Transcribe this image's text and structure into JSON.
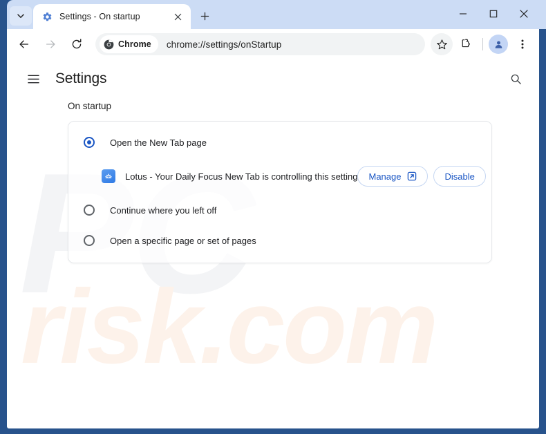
{
  "browser": {
    "tab": {
      "title": "Settings - On startup",
      "favicon_name": "settings-gear-icon",
      "close_name": "close-tab-icon"
    },
    "new_tab_label": "+",
    "tab_search_name": "tab-search-chevron-icon",
    "window_controls": {
      "minimize": "minimize-icon",
      "maximize": "maximize-icon",
      "close": "close-window-icon"
    },
    "toolbar": {
      "back": "back-arrow-icon",
      "forward": "forward-arrow-icon",
      "reload": "reload-icon",
      "chrome_chip_label": "Chrome",
      "url": "chrome://settings/onStartup",
      "bookmark": "star-icon",
      "extensions": "extensions-puzzle-icon",
      "profile": "profile-avatar-icon",
      "menu": "three-dot-menu-icon"
    }
  },
  "settings": {
    "menu_icon": "hamburger-menu-icon",
    "title": "Settings",
    "search_icon": "search-icon",
    "section_heading": "On startup",
    "options": [
      {
        "label": "Open the New Tab page",
        "checked": true
      },
      {
        "label": "Continue where you left off",
        "checked": false
      },
      {
        "label": "Open a specific page or set of pages",
        "checked": false
      }
    ],
    "extension_notice": {
      "icon_name": "lotus-extension-icon",
      "text": "Lotus - Your Daily Focus New Tab is controlling this setting",
      "manage_label": "Manage",
      "manage_icon": "open-in-new-icon",
      "disable_label": "Disable"
    }
  },
  "watermark": {
    "top": "PC",
    "bottom": "risk.com"
  },
  "colors": {
    "accent": "#1a56c4",
    "frame": "#28538c",
    "tabstrip": "#ccdcf5",
    "omnibox": "#f1f3f4"
  }
}
